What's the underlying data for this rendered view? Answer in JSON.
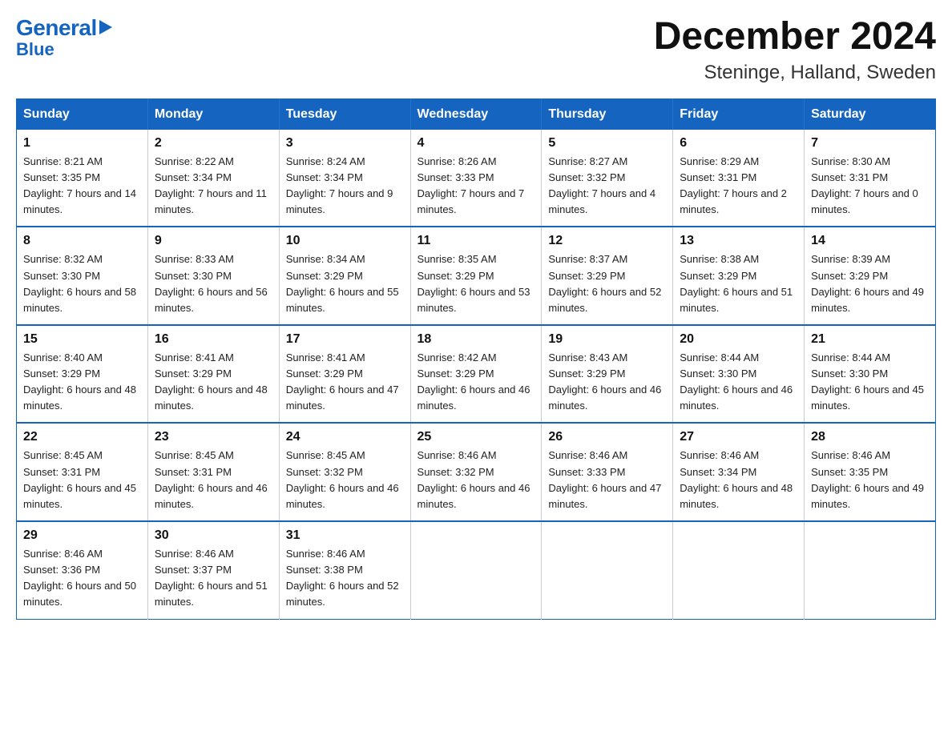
{
  "logo": {
    "general": "General",
    "blue": "Blue",
    "triangle": true
  },
  "title": "December 2024",
  "subtitle": "Steninge, Halland, Sweden",
  "header_days": [
    "Sunday",
    "Monday",
    "Tuesday",
    "Wednesday",
    "Thursday",
    "Friday",
    "Saturday"
  ],
  "weeks": [
    [
      {
        "day": "1",
        "sunrise": "Sunrise: 8:21 AM",
        "sunset": "Sunset: 3:35 PM",
        "daylight": "Daylight: 7 hours and 14 minutes."
      },
      {
        "day": "2",
        "sunrise": "Sunrise: 8:22 AM",
        "sunset": "Sunset: 3:34 PM",
        "daylight": "Daylight: 7 hours and 11 minutes."
      },
      {
        "day": "3",
        "sunrise": "Sunrise: 8:24 AM",
        "sunset": "Sunset: 3:34 PM",
        "daylight": "Daylight: 7 hours and 9 minutes."
      },
      {
        "day": "4",
        "sunrise": "Sunrise: 8:26 AM",
        "sunset": "Sunset: 3:33 PM",
        "daylight": "Daylight: 7 hours and 7 minutes."
      },
      {
        "day": "5",
        "sunrise": "Sunrise: 8:27 AM",
        "sunset": "Sunset: 3:32 PM",
        "daylight": "Daylight: 7 hours and 4 minutes."
      },
      {
        "day": "6",
        "sunrise": "Sunrise: 8:29 AM",
        "sunset": "Sunset: 3:31 PM",
        "daylight": "Daylight: 7 hours and 2 minutes."
      },
      {
        "day": "7",
        "sunrise": "Sunrise: 8:30 AM",
        "sunset": "Sunset: 3:31 PM",
        "daylight": "Daylight: 7 hours and 0 minutes."
      }
    ],
    [
      {
        "day": "8",
        "sunrise": "Sunrise: 8:32 AM",
        "sunset": "Sunset: 3:30 PM",
        "daylight": "Daylight: 6 hours and 58 minutes."
      },
      {
        "day": "9",
        "sunrise": "Sunrise: 8:33 AM",
        "sunset": "Sunset: 3:30 PM",
        "daylight": "Daylight: 6 hours and 56 minutes."
      },
      {
        "day": "10",
        "sunrise": "Sunrise: 8:34 AM",
        "sunset": "Sunset: 3:29 PM",
        "daylight": "Daylight: 6 hours and 55 minutes."
      },
      {
        "day": "11",
        "sunrise": "Sunrise: 8:35 AM",
        "sunset": "Sunset: 3:29 PM",
        "daylight": "Daylight: 6 hours and 53 minutes."
      },
      {
        "day": "12",
        "sunrise": "Sunrise: 8:37 AM",
        "sunset": "Sunset: 3:29 PM",
        "daylight": "Daylight: 6 hours and 52 minutes."
      },
      {
        "day": "13",
        "sunrise": "Sunrise: 8:38 AM",
        "sunset": "Sunset: 3:29 PM",
        "daylight": "Daylight: 6 hours and 51 minutes."
      },
      {
        "day": "14",
        "sunrise": "Sunrise: 8:39 AM",
        "sunset": "Sunset: 3:29 PM",
        "daylight": "Daylight: 6 hours and 49 minutes."
      }
    ],
    [
      {
        "day": "15",
        "sunrise": "Sunrise: 8:40 AM",
        "sunset": "Sunset: 3:29 PM",
        "daylight": "Daylight: 6 hours and 48 minutes."
      },
      {
        "day": "16",
        "sunrise": "Sunrise: 8:41 AM",
        "sunset": "Sunset: 3:29 PM",
        "daylight": "Daylight: 6 hours and 48 minutes."
      },
      {
        "day": "17",
        "sunrise": "Sunrise: 8:41 AM",
        "sunset": "Sunset: 3:29 PM",
        "daylight": "Daylight: 6 hours and 47 minutes."
      },
      {
        "day": "18",
        "sunrise": "Sunrise: 8:42 AM",
        "sunset": "Sunset: 3:29 PM",
        "daylight": "Daylight: 6 hours and 46 minutes."
      },
      {
        "day": "19",
        "sunrise": "Sunrise: 8:43 AM",
        "sunset": "Sunset: 3:29 PM",
        "daylight": "Daylight: 6 hours and 46 minutes."
      },
      {
        "day": "20",
        "sunrise": "Sunrise: 8:44 AM",
        "sunset": "Sunset: 3:30 PM",
        "daylight": "Daylight: 6 hours and 46 minutes."
      },
      {
        "day": "21",
        "sunrise": "Sunrise: 8:44 AM",
        "sunset": "Sunset: 3:30 PM",
        "daylight": "Daylight: 6 hours and 45 minutes."
      }
    ],
    [
      {
        "day": "22",
        "sunrise": "Sunrise: 8:45 AM",
        "sunset": "Sunset: 3:31 PM",
        "daylight": "Daylight: 6 hours and 45 minutes."
      },
      {
        "day": "23",
        "sunrise": "Sunrise: 8:45 AM",
        "sunset": "Sunset: 3:31 PM",
        "daylight": "Daylight: 6 hours and 46 minutes."
      },
      {
        "day": "24",
        "sunrise": "Sunrise: 8:45 AM",
        "sunset": "Sunset: 3:32 PM",
        "daylight": "Daylight: 6 hours and 46 minutes."
      },
      {
        "day": "25",
        "sunrise": "Sunrise: 8:46 AM",
        "sunset": "Sunset: 3:32 PM",
        "daylight": "Daylight: 6 hours and 46 minutes."
      },
      {
        "day": "26",
        "sunrise": "Sunrise: 8:46 AM",
        "sunset": "Sunset: 3:33 PM",
        "daylight": "Daylight: 6 hours and 47 minutes."
      },
      {
        "day": "27",
        "sunrise": "Sunrise: 8:46 AM",
        "sunset": "Sunset: 3:34 PM",
        "daylight": "Daylight: 6 hours and 48 minutes."
      },
      {
        "day": "28",
        "sunrise": "Sunrise: 8:46 AM",
        "sunset": "Sunset: 3:35 PM",
        "daylight": "Daylight: 6 hours and 49 minutes."
      }
    ],
    [
      {
        "day": "29",
        "sunrise": "Sunrise: 8:46 AM",
        "sunset": "Sunset: 3:36 PM",
        "daylight": "Daylight: 6 hours and 50 minutes."
      },
      {
        "day": "30",
        "sunrise": "Sunrise: 8:46 AM",
        "sunset": "Sunset: 3:37 PM",
        "daylight": "Daylight: 6 hours and 51 minutes."
      },
      {
        "day": "31",
        "sunrise": "Sunrise: 8:46 AM",
        "sunset": "Sunset: 3:38 PM",
        "daylight": "Daylight: 6 hours and 52 minutes."
      },
      null,
      null,
      null,
      null
    ]
  ]
}
